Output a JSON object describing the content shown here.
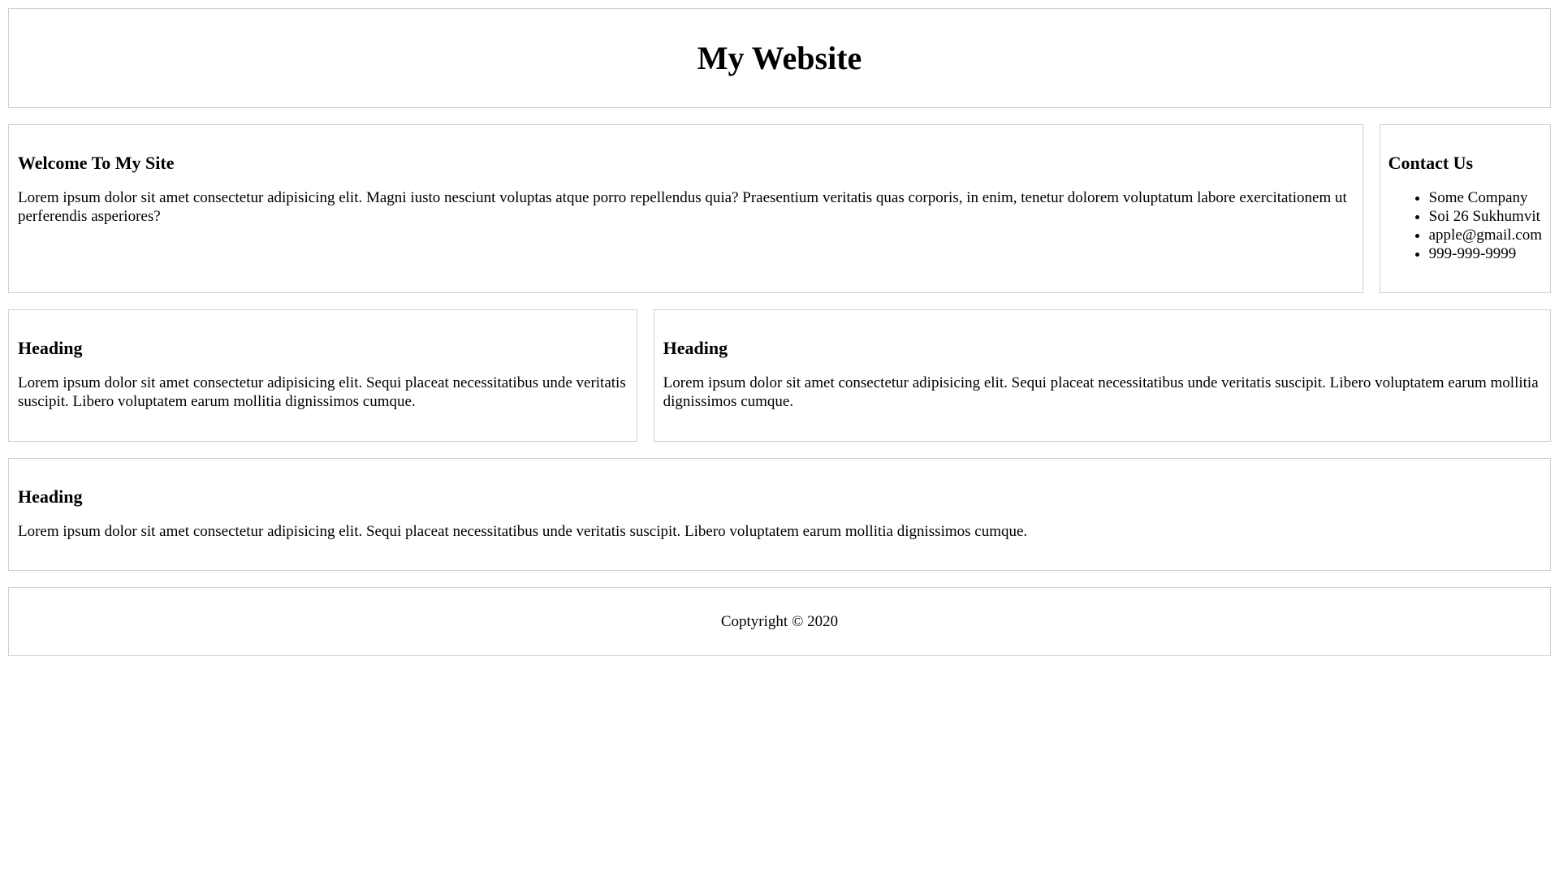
{
  "header": {
    "title": "My Website"
  },
  "welcome": {
    "heading": "Welcome To My Site",
    "text": "Lorem ipsum dolor sit amet consectetur adipisicing elit. Magni iusto nesciunt voluptas atque porro repellendus quia? Praesentium veritatis quas corporis, in enim, tenetur dolorem voluptatum labore exercitationem ut perferendis asperiores?"
  },
  "contact": {
    "heading": "Contact Us",
    "items": [
      "Some Company",
      "Soi 26 Sukhumvit",
      "apple@gmail.com",
      "999-999-9999"
    ]
  },
  "cards": [
    {
      "heading": "Heading",
      "text": "Lorem ipsum dolor sit amet consectetur adipisicing elit. Sequi placeat necessitatibus unde veritatis suscipit. Libero voluptatem earum mollitia dignissimos cumque."
    },
    {
      "heading": "Heading",
      "text": "Lorem ipsum dolor sit amet consectetur adipisicing elit. Sequi placeat necessitatibus unde veritatis suscipit. Libero voluptatem earum mollitia dignissimos cumque."
    },
    {
      "heading": "Heading",
      "text": "Lorem ipsum dolor sit amet consectetur adipisicing elit. Sequi placeat necessitatibus unde veritatis suscipit. Libero voluptatem earum mollitia dignissimos cumque."
    }
  ],
  "footer": {
    "copyright": "Coptyright © 2020"
  },
  "colors": {
    "border": "#cfcfcf",
    "background": "#ffffff",
    "text": "#000000"
  }
}
